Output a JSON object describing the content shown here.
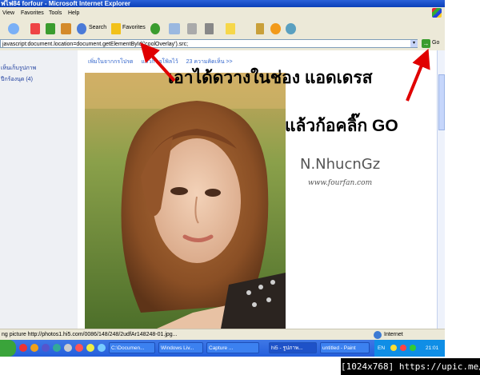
{
  "window": {
    "title": "ฟไฟ84 forfour - Microsoft Internet Explorer"
  },
  "menu": [
    "View",
    "Favorites",
    "Tools",
    "Help"
  ],
  "toolbar": {
    "search_label": "Search",
    "favorites_label": "Favorites"
  },
  "address": {
    "value": "javascript:document.location=document.getElementById('coolOverlay').src;",
    "go_label": "Go"
  },
  "left_panel": {
    "link1": "เห็นเก็บรูปภาพ",
    "link2": "ปีกร้องนุด (4)"
  },
  "nav": {
    "link1": "เพิ่มในจากกรโปรด",
    "link2": "แล้วก็ขอโพิลไว้",
    "link3": "23 ความคิดเห็น >>"
  },
  "annotations": {
    "caption1": "เอาได้ดวางในช่อง แอดเดรส",
    "caption2": "แล้วก้อคลิ๊ก GO",
    "watermark_name": "N.NhucnGz",
    "watermark_url": "www.fourfan.com"
  },
  "status": {
    "text": "ng picture http://photos1.hi5.com/0086/148/248/2udfAr148248-01.jpg...",
    "zone": "Internet"
  },
  "taskbar": {
    "items": [
      "C:\\Documen...",
      "Windows Liv...",
      "Capture ...",
      "hi5 - รูปภาพ...",
      "untitled - Paint"
    ],
    "lang": "EN",
    "clock": "21:01"
  },
  "footer": "[1024x768] https://upic.me/"
}
